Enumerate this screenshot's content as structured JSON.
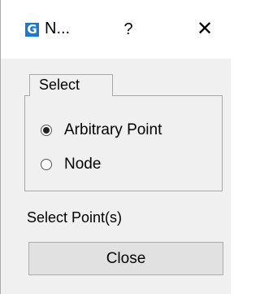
{
  "window": {
    "title": "N...",
    "icon_letter": "G",
    "icon_name": "app-logo-icon",
    "help_label": "?",
    "close_label": "✕",
    "accent_color": "#1a78d6"
  },
  "select_group": {
    "label": "Select",
    "options": [
      {
        "label": "Arbitrary Point",
        "checked": true
      },
      {
        "label": "Node",
        "checked": false
      }
    ]
  },
  "prompt": "Select Point(s)",
  "close_button_label": "Close"
}
